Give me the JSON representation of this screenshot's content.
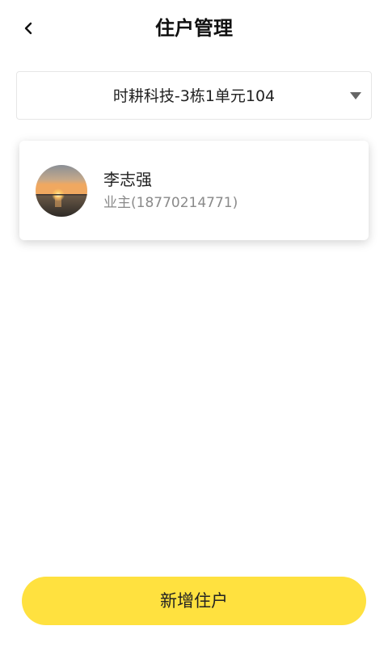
{
  "header": {
    "title": "住户管理",
    "back_icon": "chevron-left-icon"
  },
  "unit_selector": {
    "selected": "时耕科技-3栋1单元104",
    "arrow_icon": "caret-down-icon"
  },
  "residents": [
    {
      "name": "李志强",
      "role": "业主(18770214771)",
      "avatar": "sunset-photo-avatar"
    }
  ],
  "footer": {
    "add_button_label": "新增住户"
  },
  "colors": {
    "accent": "#ffe13f",
    "secondary_text": "#8a8a8a",
    "border": "#e6e6e6"
  }
}
